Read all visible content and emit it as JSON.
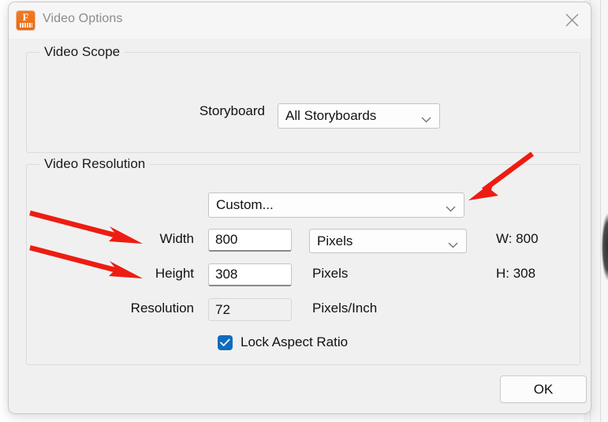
{
  "window": {
    "title": "Video Options",
    "app_icon": "filmora-app-icon",
    "icon_letter": "F",
    "close_label": "×"
  },
  "video_scope": {
    "legend": "Video Scope",
    "storyboard_label": "Storyboard",
    "storyboard_value": "All Storyboards"
  },
  "video_resolution": {
    "legend": "Video Resolution",
    "preset_value": "Custom...",
    "width_label": "Width",
    "width_value": "800",
    "width_unit": "Pixels",
    "height_label": "Height",
    "height_value": "308",
    "height_unit": "Pixels",
    "resolution_label": "Resolution",
    "resolution_value": "72",
    "resolution_unit": "Pixels/Inch",
    "lock_aspect_label": "Lock Aspect Ratio",
    "lock_aspect_checked": true,
    "readout_width": "W: 800",
    "readout_height": "H: 308"
  },
  "footer": {
    "ok_label": "OK"
  },
  "annotations": {
    "arrow_color": "#ee1c12",
    "arrow_preset": "arrow-pointing-to-preset-dropdown",
    "arrow_width": "arrow-pointing-to-width-field",
    "arrow_height": "arrow-pointing-to-height-field"
  },
  "colors": {
    "dialog_background": "#f0f0f0",
    "titlebar_background": "#f6f6f6",
    "accent_checkbox": "#0f6cbd",
    "app_icon_orange": "#f47920",
    "annotation_red": "#ee1c12"
  }
}
